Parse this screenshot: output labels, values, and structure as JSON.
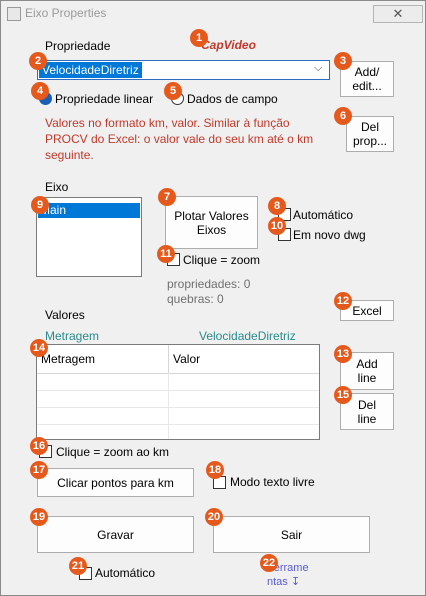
{
  "window": {
    "title": "Eixo Properties",
    "close_symbol": "✕"
  },
  "brand": "CapVideo",
  "propriedade": {
    "label": "Propriedade",
    "selected": "VelocidadeDiretriz",
    "add_edit": [
      "Add/",
      "edit..."
    ],
    "radio_linear": "Propriedade linear",
    "radio_campo": "Dados de campo",
    "hint": [
      "Valores no formato km, valor. Similar à função",
      "PROCV do Excel: o valor vale do seu km até o km",
      "seguinte."
    ],
    "del_prop": [
      "Del",
      "prop..."
    ]
  },
  "eixo": {
    "label": "Eixo",
    "items": [
      "Main"
    ],
    "plot_button": [
      "Plotar Valores",
      "Eixos"
    ],
    "automatico": "Automático",
    "novo_dwg": "Em novo dwg",
    "clique_zoom": "Clique = zoom",
    "propriedades": "propriedades: 0",
    "quebras": "quebras: 0"
  },
  "valores": {
    "label": "Valores",
    "excel": "Excel",
    "col_left_caption": "Metragem",
    "col_right_caption": "VelocidadeDiretriz",
    "table_headers": [
      "Metragem",
      "Valor"
    ],
    "add_line": [
      "Add",
      "line"
    ],
    "del_line": [
      "Del",
      "line"
    ],
    "clique_zoom_km": "Clique = zoom ao km",
    "clicar_pontos": "Clicar pontos para km",
    "modo_texto": "Modo texto livre"
  },
  "footer": {
    "gravar": "Gravar",
    "sair": "Sair",
    "automatico": "Automático",
    "ferramentas": [
      "Ferrame",
      "ntas ↧"
    ]
  },
  "badges": [
    "1",
    "2",
    "3",
    "4",
    "5",
    "6",
    "7",
    "8",
    "9",
    "10",
    "11",
    "12",
    "13",
    "14",
    "15",
    "16",
    "17",
    "18",
    "19",
    "20",
    "21",
    "22"
  ],
  "colors": {
    "badge": "#e55a1c",
    "hint": "#c0392b",
    "caption": "#2a8a8a",
    "link": "#5b5bd6",
    "selection": "#0078d7"
  }
}
